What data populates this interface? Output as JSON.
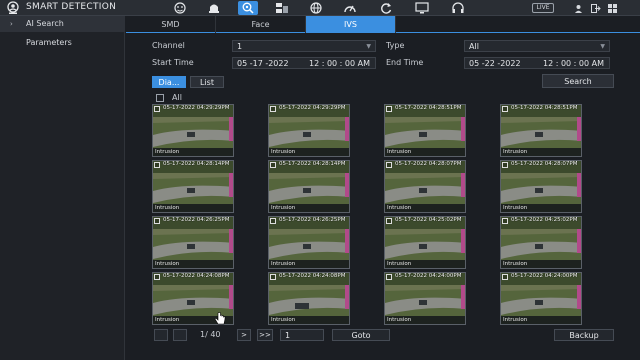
{
  "topbar": {
    "title": "SMART DETECTION",
    "live_label": "LIVE",
    "nav_icons": [
      "face-detect-icon",
      "cctv-camera-icon",
      "ai-search-icon",
      "storage-icon",
      "network-globe-icon",
      "gauge-icon",
      "refresh-icon",
      "monitor-icon",
      "headset-icon"
    ],
    "accent": "#3b8fe0"
  },
  "sidebar": {
    "items": [
      {
        "label": "AI Search",
        "active": true
      },
      {
        "label": "Parameters",
        "active": false
      }
    ]
  },
  "tabs": [
    {
      "label": "SMD",
      "active": false
    },
    {
      "label": "Face",
      "active": false
    },
    {
      "label": "IVS",
      "active": true
    }
  ],
  "filters": {
    "channel_label": "Channel",
    "channel_value": "1",
    "type_label": "Type",
    "type_value": "All",
    "start_label": "Start Time",
    "start_date": "05 -17 -2022",
    "start_time": "12 : 00 : 00 AM",
    "end_label": "End Time",
    "end_date": "05 -22 -2022",
    "end_time": "12 : 00 : 00 AM",
    "search_label": "Search"
  },
  "view": {
    "diagram_label": "Dia...",
    "list_label": "List",
    "all_label": "All"
  },
  "results": [
    {
      "time": "05-17-2022 04:29:29PM",
      "tag": "Intrusion"
    },
    {
      "time": "05-17-2022 04:29:29PM",
      "tag": "Intrusion"
    },
    {
      "time": "05-17-2022 04:28:51PM",
      "tag": "Intrusion"
    },
    {
      "time": "05-17-2022 04:28:51PM",
      "tag": "Intrusion"
    },
    {
      "time": "05-17-2022 04:28:14PM",
      "tag": "Intrusion"
    },
    {
      "time": "05-17-2022 04:28:14PM",
      "tag": "Intrusion"
    },
    {
      "time": "05-17-2022 04:28:07PM",
      "tag": "Intrusion"
    },
    {
      "time": "05-17-2022 04:28:07PM",
      "tag": "Intrusion"
    },
    {
      "time": "05-17-2022 04:26:25PM",
      "tag": "Intrusion"
    },
    {
      "time": "05-17-2022 04:26:25PM",
      "tag": "Intrusion"
    },
    {
      "time": "05-17-2022 04:25:02PM",
      "tag": "Intrusion"
    },
    {
      "time": "05-17-2022 04:25:02PM",
      "tag": "Intrusion"
    },
    {
      "time": "05-17-2022 04:24:08PM",
      "tag": "Intrusion"
    },
    {
      "time": "05-17-2022 04:24:08PM",
      "tag": "Intrusion"
    },
    {
      "time": "05-17-2022 04:24:00PM",
      "tag": "Intrusion"
    },
    {
      "time": "05-17-2022 04:24:00PM",
      "tag": "Intrusion"
    }
  ],
  "pager": {
    "page_text": "1/ 40",
    "next_label": ">",
    "last_label": ">>",
    "goto_value": "1",
    "goto_label": "Goto",
    "backup_label": "Backup"
  }
}
